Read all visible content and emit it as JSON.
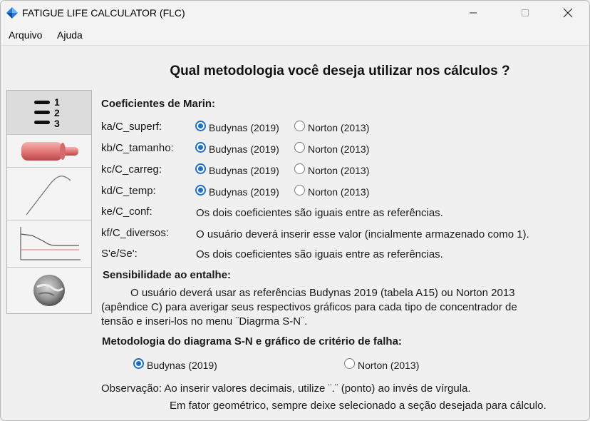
{
  "window": {
    "title": "FATIGUE LIFE CALCULATOR (FLC)"
  },
  "menu": {
    "file": "Arquivo",
    "help": "Ajuda"
  },
  "main": {
    "question": "Qual metodologia você deseja utilizar nos cálculos ?"
  },
  "sidebar": {
    "items": [
      {
        "icon": "numbered-list-icon"
      },
      {
        "icon": "shaft-icon"
      },
      {
        "icon": "stress-strain-curve-icon"
      },
      {
        "icon": "sn-diagram-icon"
      },
      {
        "icon": "material-sample-icon"
      }
    ]
  },
  "marin": {
    "title": "Coeficientes de Marin:",
    "rows": [
      {
        "label": "ka/C_superf:",
        "opt1": "Budynas (2019)",
        "opt2": "Norton (2013)",
        "selected": "Budynas (2019)"
      },
      {
        "label": "kb/C_tamanho:",
        "opt1": "Budynas (2019)",
        "opt2": "Norton (2013)",
        "selected": "Budynas (2019)"
      },
      {
        "label": "kc/C_carreg:",
        "opt1": "Budynas (2019)",
        "opt2": "Norton (2013)",
        "selected": "Budynas (2019)"
      },
      {
        "label": "kd/C_temp:",
        "opt1": "Budynas (2019)",
        "opt2": "Norton (2013)",
        "selected": "Budynas (2019)"
      }
    ],
    "info_rows": [
      {
        "label": "ke/C_conf:",
        "text": "Os dois coeficientes são iguais entre as referências."
      },
      {
        "label": "kf/C_diversos:",
        "text": "O usuário deverá inserir esse valor (incialmente armazenado como 1)."
      },
      {
        "label": "S'e/Se':",
        "text": "Os dois coeficientes são iguais entre as referências."
      }
    ]
  },
  "notch": {
    "title": "Sensibilidade ao entalhe:",
    "line1": "O usuário deverá usar as referências Budynas 2019 (tabela A15) ou Norton 2013",
    "line2": "(apêndice C)  para averigar seus respectivos gráficos para cada tipo de concentrador de",
    "line3": "tensão e inseri-los no menu ¨Diagrma S-N¨."
  },
  "sn": {
    "title": "Metodologia do diagrama S-N e gráfico de critério de falha:",
    "opt1": "Budynas (2019)",
    "opt2": "Norton (2013)",
    "selected": "Budynas (2019)"
  },
  "notes": {
    "line1": "Observação: Ao inserir valores decimais, utilize ¨.¨ (ponto) ao invés de vírgula.",
    "line2": "Em fator geométrico, sempre deixe selecionado a seção desejada para cálculo."
  },
  "colors": {
    "accent": "#1f6fc5",
    "background": "#f0f0f0"
  }
}
